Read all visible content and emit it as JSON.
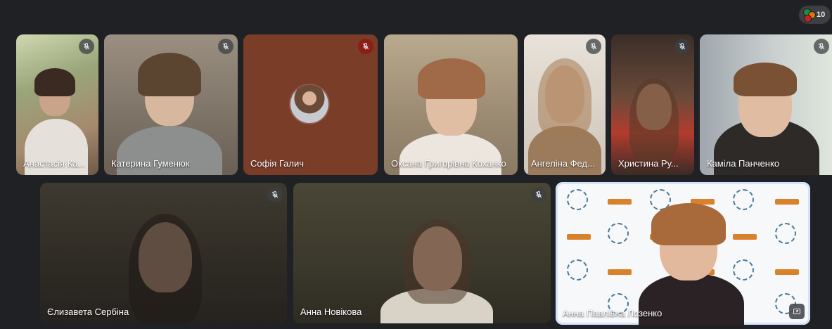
{
  "participants_count": "10",
  "participants": [
    {
      "name": "Анастасія Ка...",
      "muted": true
    },
    {
      "name": "Катерина Гуменюк",
      "muted": true
    },
    {
      "name": "Софія Галич",
      "muted": true
    },
    {
      "name": "Оксана Григорівна Коханко",
      "muted": false
    },
    {
      "name": "Ангеліна Фед...",
      "muted": true
    },
    {
      "name": "Христина Ру...",
      "muted": true
    },
    {
      "name": "Каміла Панченко",
      "muted": true
    },
    {
      "name": "Єлизавета Сербіна",
      "muted": true
    },
    {
      "name": "Анна Новікова",
      "muted": true
    },
    {
      "name": "Анна Павлівна Лозенко",
      "muted": false
    }
  ]
}
